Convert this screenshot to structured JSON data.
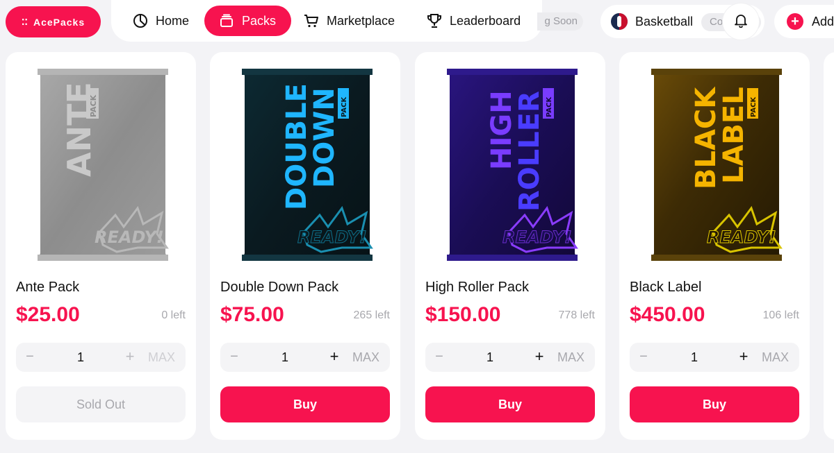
{
  "header": {
    "logo_text": "AcePacks",
    "nav": [
      {
        "label": "Home",
        "icon": "pie-chart-icon"
      },
      {
        "label": "Packs",
        "icon": "cards-stack-icon",
        "active": true
      },
      {
        "label": "Marketplace",
        "icon": "shopping-cart-icon"
      },
      {
        "label": "Leaderboard",
        "icon": "trophy-icon"
      }
    ],
    "coming_soon": "g Soon",
    "sport_label": "Basketball",
    "collection_chip": "Co        oc",
    "add_label": "Add"
  },
  "cards": [
    {
      "name": "Ante Pack",
      "price": "$25.00",
      "left": "0 left",
      "quantity": "1",
      "minus": "−",
      "plus": "+",
      "max": "MAX",
      "cta": "Sold Out",
      "pack_line1": "ANTE",
      "pack_line2": "",
      "pack_badge": "PACK",
      "pack_stamp": "READY!"
    },
    {
      "name": "Double Down Pack",
      "price": "$75.00",
      "left": "265 left",
      "quantity": "1",
      "minus": "−",
      "plus": "+",
      "max": "MAX",
      "cta": "Buy",
      "pack_line1": "DOUBLE",
      "pack_line2": "DOWN",
      "pack_badge": "PACK",
      "pack_stamp": "READY!"
    },
    {
      "name": "High Roller Pack",
      "price": "$150.00",
      "left": "778 left",
      "quantity": "1",
      "minus": "−",
      "plus": "+",
      "max": "MAX",
      "cta": "Buy",
      "pack_line1": "HIGH",
      "pack_line2": "ROLLER",
      "pack_badge": "PACK",
      "pack_stamp": "READY!"
    },
    {
      "name": "Black Label",
      "price": "$450.00",
      "left": "106 left",
      "quantity": "1",
      "minus": "−",
      "plus": "+",
      "max": "MAX",
      "cta": "Buy",
      "pack_line1": "BLACK",
      "pack_line2": "LABEL",
      "pack_badge": "PACK",
      "pack_stamp": "READY!"
    }
  ],
  "colors": {
    "accent": "#f7134f",
    "muted_text": "#a8a8ad",
    "pack_ante": "#8a8a8a",
    "pack_double_down": "#1fb6ff",
    "pack_high_roller": "#5b2bff",
    "pack_black_label": "#f5b400"
  }
}
